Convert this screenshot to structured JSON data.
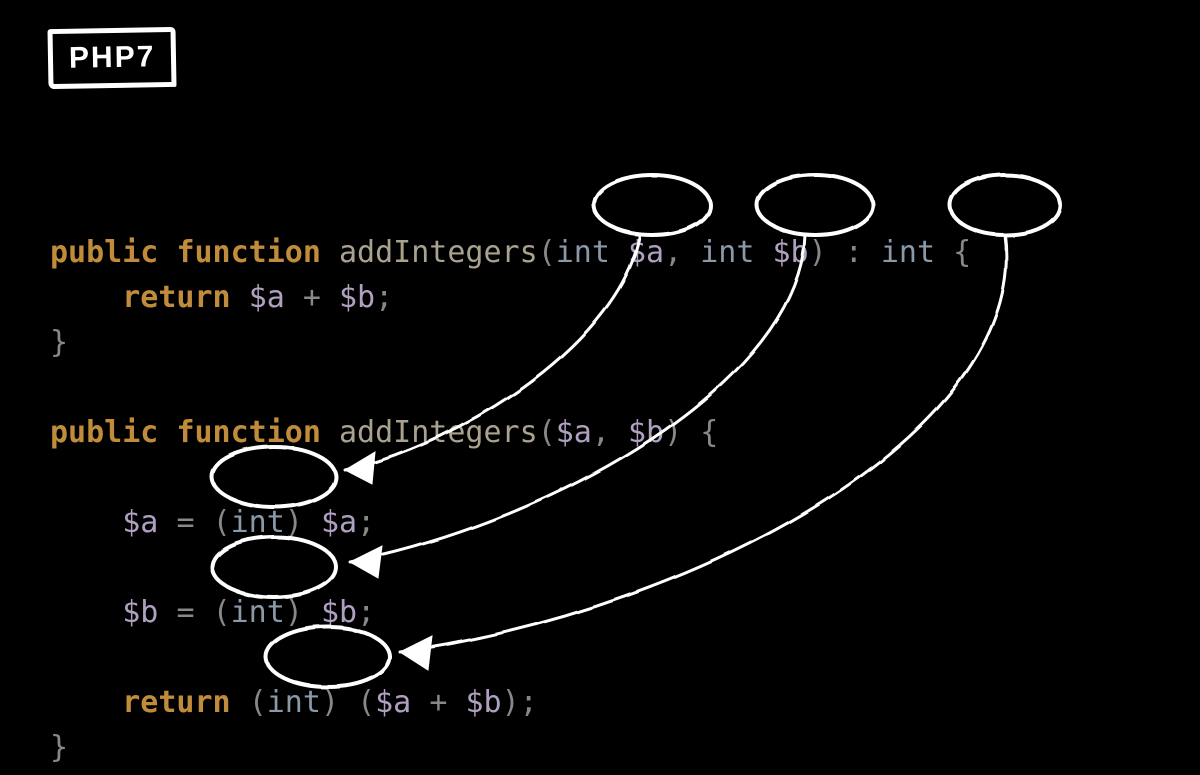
{
  "badge": "PHP7",
  "tokens": {
    "kw_public": "public",
    "kw_function": "function",
    "fn_name": "addIntegers",
    "type_int": "int",
    "var_a": "$a",
    "var_b": "$b",
    "kw_return": "return",
    "op_plus": "+",
    "op_eq": "="
  },
  "annotations": {
    "circles_top": [
      {
        "id": "circle-param-a-type",
        "label": "int type hint on $a"
      },
      {
        "id": "circle-param-b-type",
        "label": "int type hint on $b"
      },
      {
        "id": "circle-return-type",
        "label": ": int return type"
      }
    ],
    "circles_bottom": [
      {
        "id": "circle-cast-a",
        "label": "(int) cast for $a"
      },
      {
        "id": "circle-cast-b",
        "label": "(int) cast for $b"
      },
      {
        "id": "circle-cast-return",
        "label": "(int) cast on return"
      }
    ],
    "arrows": [
      {
        "from": "circle-param-a-type",
        "to": "circle-cast-a"
      },
      {
        "from": "circle-param-b-type",
        "to": "circle-cast-b"
      },
      {
        "from": "circle-return-type",
        "to": "circle-cast-return"
      }
    ]
  },
  "colors": {
    "keyword": "#c08c3c",
    "function_name": "#a9a28e",
    "type": "#8a99a8",
    "variable": "#b0a0c0",
    "punct": "#888888",
    "annotation": "#ffffff",
    "background": "#000000"
  }
}
